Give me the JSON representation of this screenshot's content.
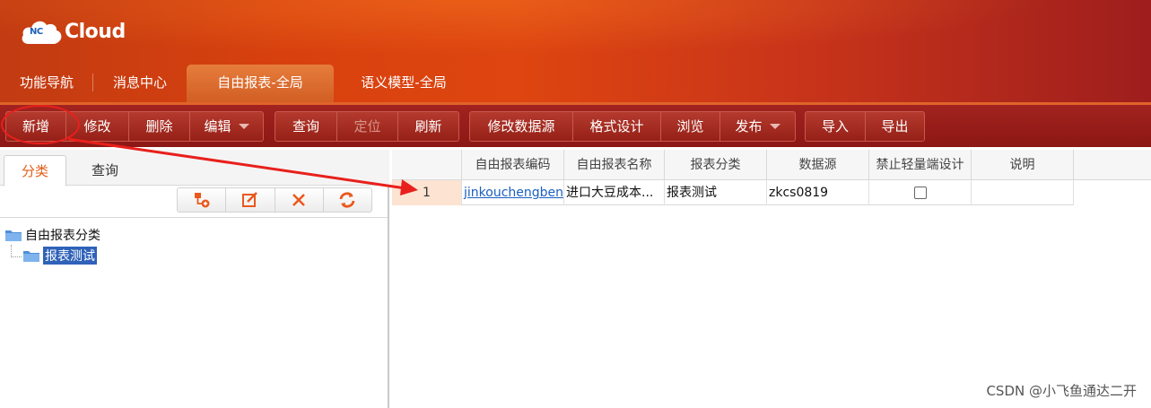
{
  "app": {
    "logo_badge": "NC",
    "logo_text": "Cloud",
    "brand_color": "#d8410e"
  },
  "nav": {
    "tabs": [
      {
        "label": "功能导航",
        "active": false
      },
      {
        "label": "消息中心",
        "active": false
      },
      {
        "label": "自由报表-全局",
        "active": true
      },
      {
        "label": "语义模型-全局",
        "active": false
      }
    ]
  },
  "toolbar": {
    "add": "新增",
    "modify": "修改",
    "delete": "删除",
    "edit": "编辑",
    "query": "查询",
    "locate": "定位",
    "refresh": "刷新",
    "modify_datasource": "修改数据源",
    "format_design": "格式设计",
    "browse": "浏览",
    "publish": "发布",
    "import": "导入",
    "export": "导出"
  },
  "left_panel": {
    "tabs": [
      {
        "label": "分类",
        "active": true
      },
      {
        "label": "查询",
        "active": false
      }
    ],
    "tree_tools": [
      "add-node-icon",
      "edit-icon",
      "delete-icon",
      "refresh-icon"
    ],
    "tree": {
      "root": "自由报表分类",
      "children": [
        {
          "label": "报表测试",
          "selected": true
        }
      ]
    }
  },
  "grid": {
    "columns": [
      "",
      "自由报表编码",
      "自由报表名称",
      "报表分类",
      "数据源",
      "禁止轻量端设计",
      "说明"
    ],
    "rows": [
      {
        "num": "1",
        "code": "jinkouchengben",
        "name": "进口大豆成本...",
        "category": "报表测试",
        "datasource": "zkcs0819",
        "disable_light_design": false,
        "description": ""
      }
    ]
  },
  "watermark": "CSDN @小飞鱼通达二开",
  "annotation_color": "#e8201c"
}
